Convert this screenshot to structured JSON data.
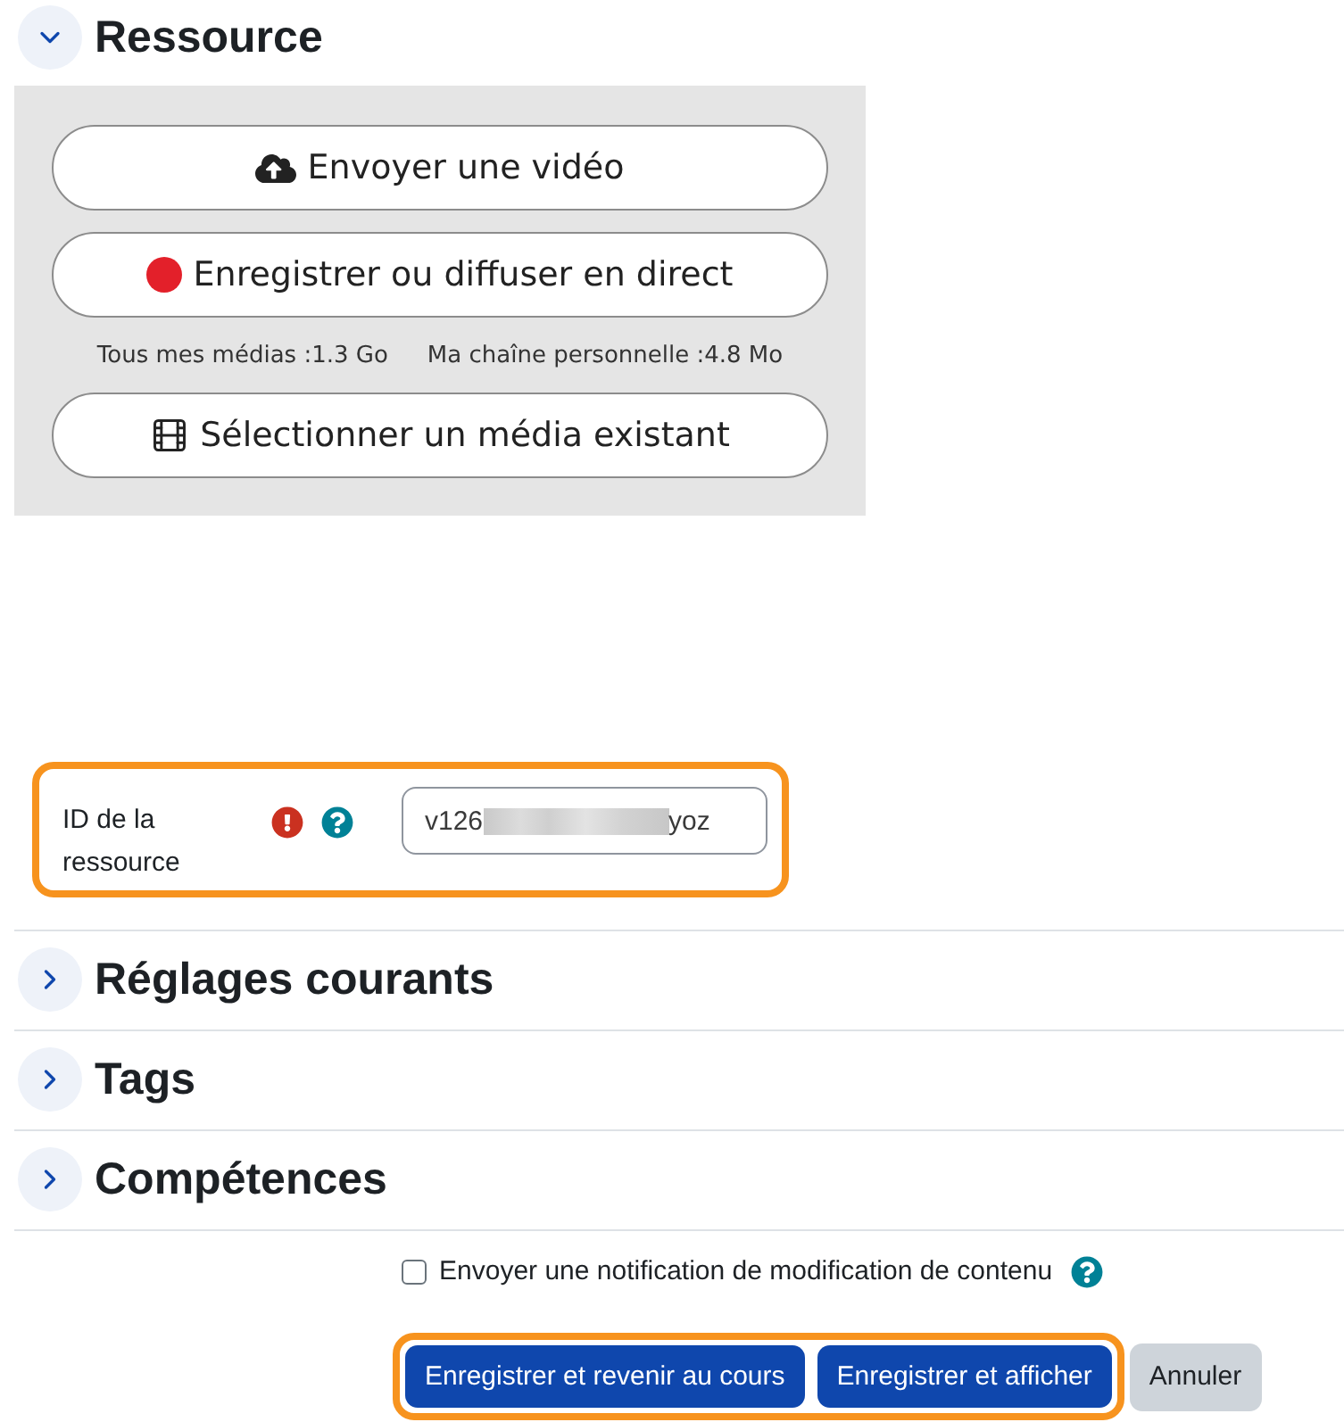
{
  "sections": [
    {
      "title": "Ressource",
      "expanded": true,
      "media_panel": [
        {
          "kind": "upload",
          "label": "Envoyer une vidéo"
        },
        {
          "kind": "record",
          "label": "Enregistrer ou diffuser en direct"
        },
        {
          "kind": "quota",
          "items": [
            "Tous mes médias :1.3 Go",
            "Ma chaîne personnelle :4.8 Mo"
          ]
        },
        {
          "kind": "select",
          "label": "Sélectionner un média existant"
        }
      ],
      "id_field": {
        "label": "ID de la ressource",
        "required": true,
        "help": true,
        "value_start": "v126",
        "redacted": true,
        "value_end": "yoz",
        "highlighted": true
      }
    },
    {
      "title": "Réglages courants",
      "expanded": false
    },
    {
      "title": "Tags",
      "expanded": false
    },
    {
      "title": "Compétences",
      "expanded": false
    }
  ],
  "notify": {
    "label": "Envoyer une notification de modification de contenu",
    "checked": false,
    "help": true
  },
  "buttons": [
    {
      "label": "Enregistrer et revenir au cours",
      "kind": "primary",
      "highlighted": true
    },
    {
      "label": "Enregistrer et afficher",
      "kind": "primary",
      "highlighted": true
    },
    {
      "label": "Annuler",
      "kind": "secondary",
      "highlighted": false
    }
  ]
}
